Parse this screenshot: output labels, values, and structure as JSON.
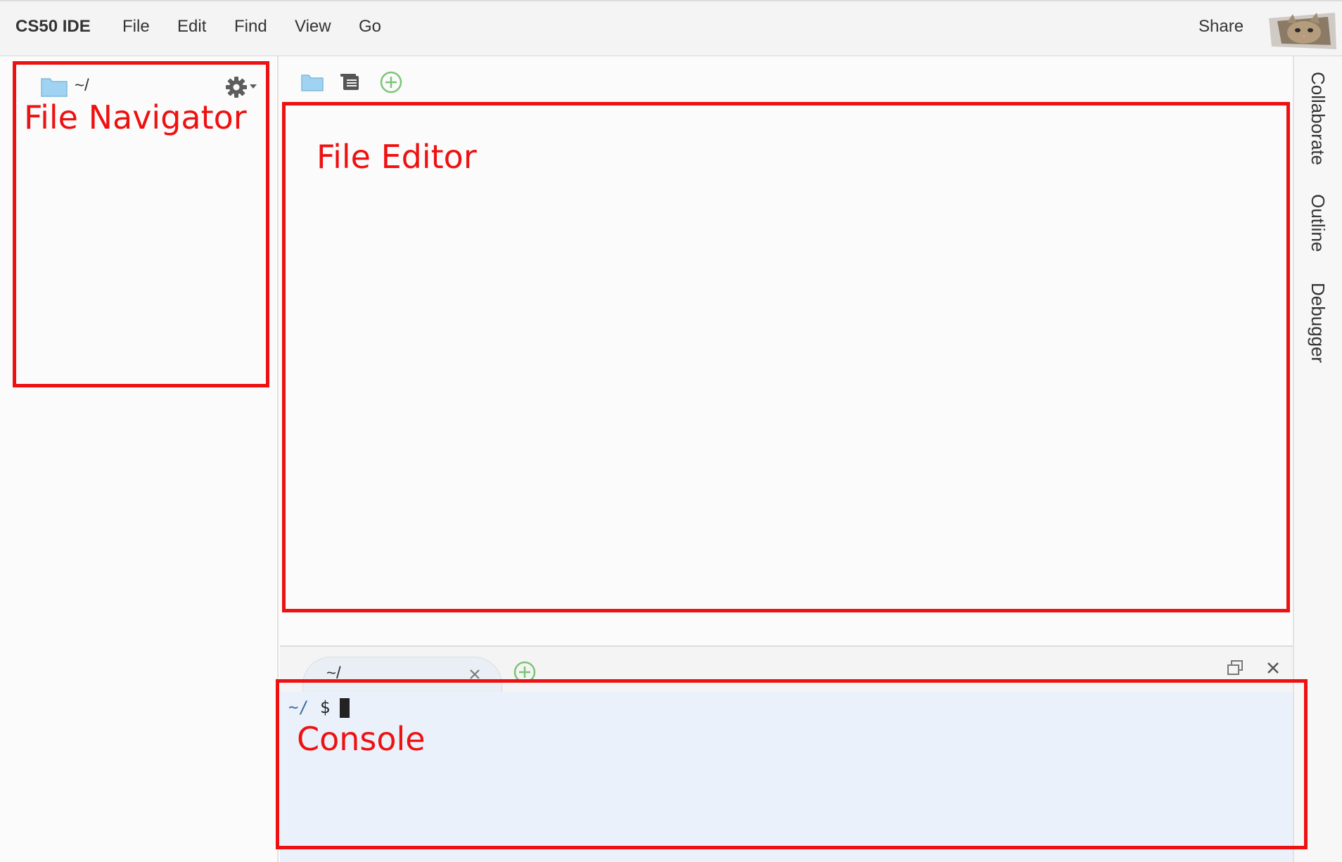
{
  "app": {
    "title": "CS50 IDE"
  },
  "menu": {
    "items": [
      "File",
      "Edit",
      "Find",
      "View",
      "Go"
    ],
    "share_label": "Share"
  },
  "navigator": {
    "root_label": "~/"
  },
  "right_panel": {
    "tabs": [
      "Collaborate",
      "Outline",
      "Debugger"
    ]
  },
  "console": {
    "tab_label": "~/",
    "prompt_cwd": "~/",
    "prompt_symbol": "$"
  },
  "annotations": {
    "file_navigator": "File Navigator",
    "file_editor": "File Editor",
    "console": "Console"
  },
  "icons": {
    "folder": "folder-icon",
    "outline": "outline-icon",
    "add": "add-icon",
    "gear": "gear-icon",
    "close": "close-icon",
    "restore": "restore-window-icon"
  },
  "colors": {
    "annotation_red": "#ee1111",
    "add_green": "#7cc576",
    "folder_blue": "#9fd3f1"
  }
}
